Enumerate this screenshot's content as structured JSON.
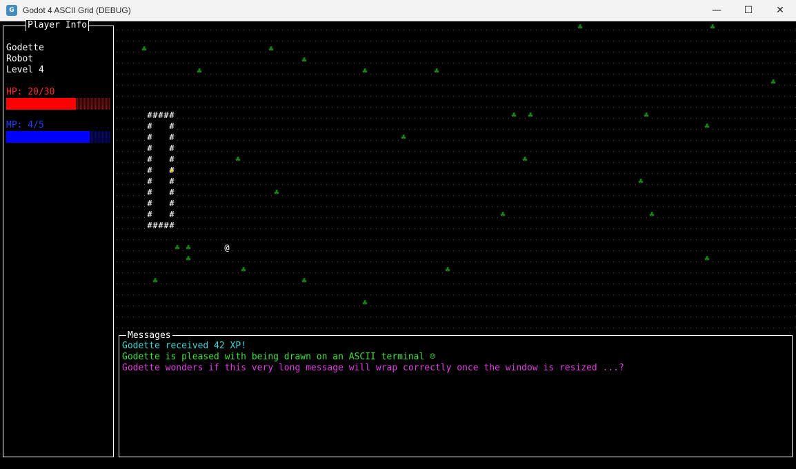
{
  "window": {
    "title": "Godot 4 ASCII Grid (DEBUG)",
    "icon": "godot-icon",
    "minimize": "—",
    "maximize": "☐",
    "close": "✕"
  },
  "player_panel": {
    "title": "Player Info",
    "name": "Godette",
    "class": "Robot",
    "level": "Level 4",
    "hp_label": "HP: 20/30",
    "hp_fraction": 0.667,
    "mp_label": "MP: 4/5",
    "mp_fraction": 0.8,
    "hp_color": "#ff0000",
    "mp_color": "#0000ff"
  },
  "map": {
    "wall_char": "#",
    "player_char": "@",
    "item_char": "+",
    "tree_char": "♣",
    "floor_char": ".",
    "tree_color": "#1a8a1a",
    "item_color": "#ffd700"
  },
  "messages_panel": {
    "title": "Messages",
    "lines": [
      {
        "text": "Godette received 42 XP!",
        "color": "#3fd8d8"
      },
      {
        "text": "Godette is pleased with being drawn on an ASCII terminal ☺",
        "color": "#3fe03f"
      },
      {
        "text": "Godette wonders if this very long message will wrap correctly once the window is resized ...?",
        "color": "#e03fe0"
      }
    ]
  }
}
